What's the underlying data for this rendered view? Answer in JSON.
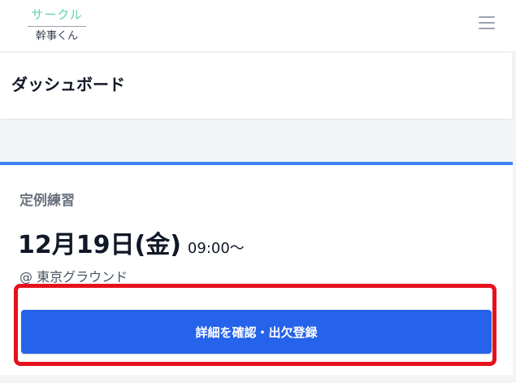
{
  "header": {
    "logo_top": "サークル",
    "logo_bottom": "幹事くん",
    "menu_icon": "hamburger-menu-icon"
  },
  "page": {
    "title": "ダッシュボード"
  },
  "event": {
    "category": "定例練習",
    "date": "12月19日(金)",
    "time": "09:00〜",
    "location": "@ 東京グラウンド",
    "button_label": "詳細を確認・出欠登録"
  },
  "colors": {
    "logo_accent": "#5fd3a8",
    "card_top_border": "#3b82f6",
    "button": "#2563eb",
    "highlight_box": "#e5121d",
    "background": "#f3f4f6"
  }
}
